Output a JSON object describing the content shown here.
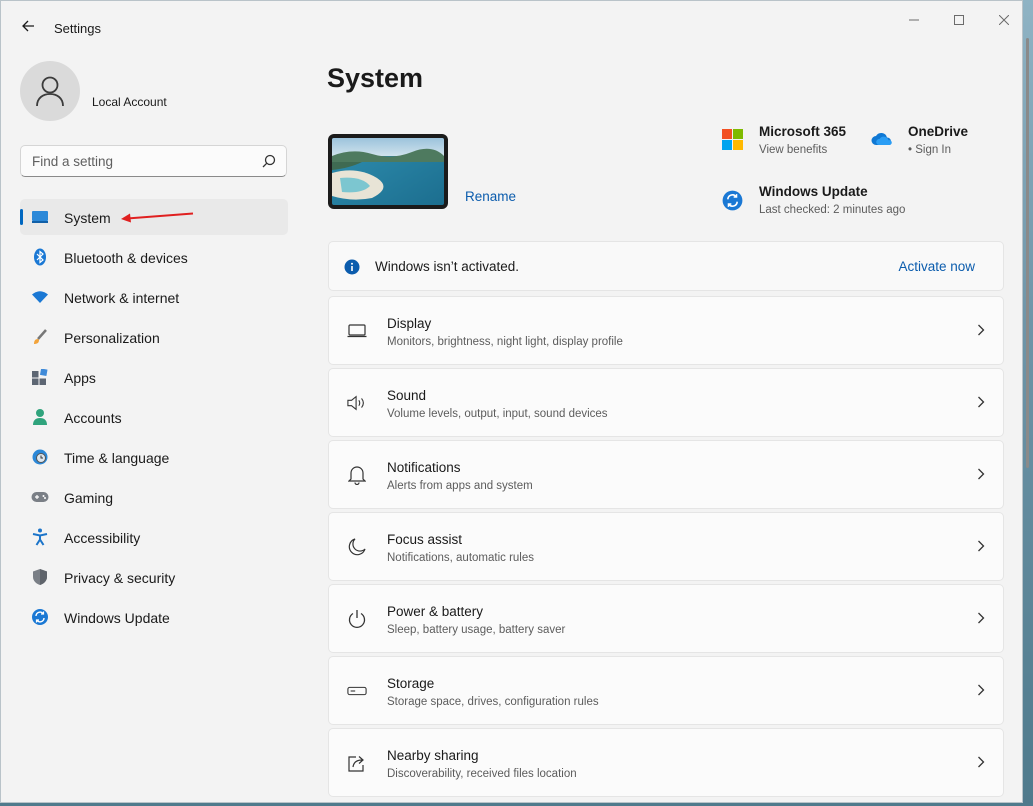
{
  "window": {
    "title": "Settings"
  },
  "account": {
    "name": "Local Account"
  },
  "search": {
    "placeholder": "Find a setting"
  },
  "sidebar": {
    "items": [
      {
        "label": "System",
        "icon": "monitor-icon",
        "active": true
      },
      {
        "label": "Bluetooth & devices",
        "icon": "bluetooth-icon"
      },
      {
        "label": "Network & internet",
        "icon": "wifi-icon"
      },
      {
        "label": "Personalization",
        "icon": "brush-icon"
      },
      {
        "label": "Apps",
        "icon": "apps-icon"
      },
      {
        "label": "Accounts",
        "icon": "person-icon"
      },
      {
        "label": "Time & language",
        "icon": "globe-clock-icon"
      },
      {
        "label": "Gaming",
        "icon": "gamepad-icon"
      },
      {
        "label": "Accessibility",
        "icon": "accessibility-icon"
      },
      {
        "label": "Privacy & security",
        "icon": "shield-icon"
      },
      {
        "label": "Windows Update",
        "icon": "update-icon"
      }
    ]
  },
  "main": {
    "title": "System",
    "rename_label": "Rename",
    "services": {
      "m365": {
        "title": "Microsoft 365",
        "sub": "View benefits"
      },
      "onedrive": {
        "title": "OneDrive",
        "sub": "• Sign In"
      },
      "update": {
        "title": "Windows Update",
        "sub": "Last checked: 2 minutes ago"
      }
    },
    "activation": {
      "text": "Windows isn’t activated.",
      "link": "Activate now"
    },
    "cards": [
      {
        "title": "Display",
        "sub": "Monitors, brightness, night light, display profile",
        "icon": "display-icon"
      },
      {
        "title": "Sound",
        "sub": "Volume levels, output, input, sound devices",
        "icon": "speaker-icon"
      },
      {
        "title": "Notifications",
        "sub": "Alerts from apps and system",
        "icon": "bell-icon"
      },
      {
        "title": "Focus assist",
        "sub": "Notifications, automatic rules",
        "icon": "moon-icon"
      },
      {
        "title": "Power & battery",
        "sub": "Sleep, battery usage, battery saver",
        "icon": "power-icon"
      },
      {
        "title": "Storage",
        "sub": "Storage space, drives, configuration rules",
        "icon": "storage-icon"
      },
      {
        "title": "Nearby sharing",
        "sub": "Discoverability, received files location",
        "icon": "share-icon"
      }
    ]
  },
  "colors": {
    "accent": "#0067c0",
    "link": "#0b5cad",
    "annotation_arrow": "#e02020"
  }
}
